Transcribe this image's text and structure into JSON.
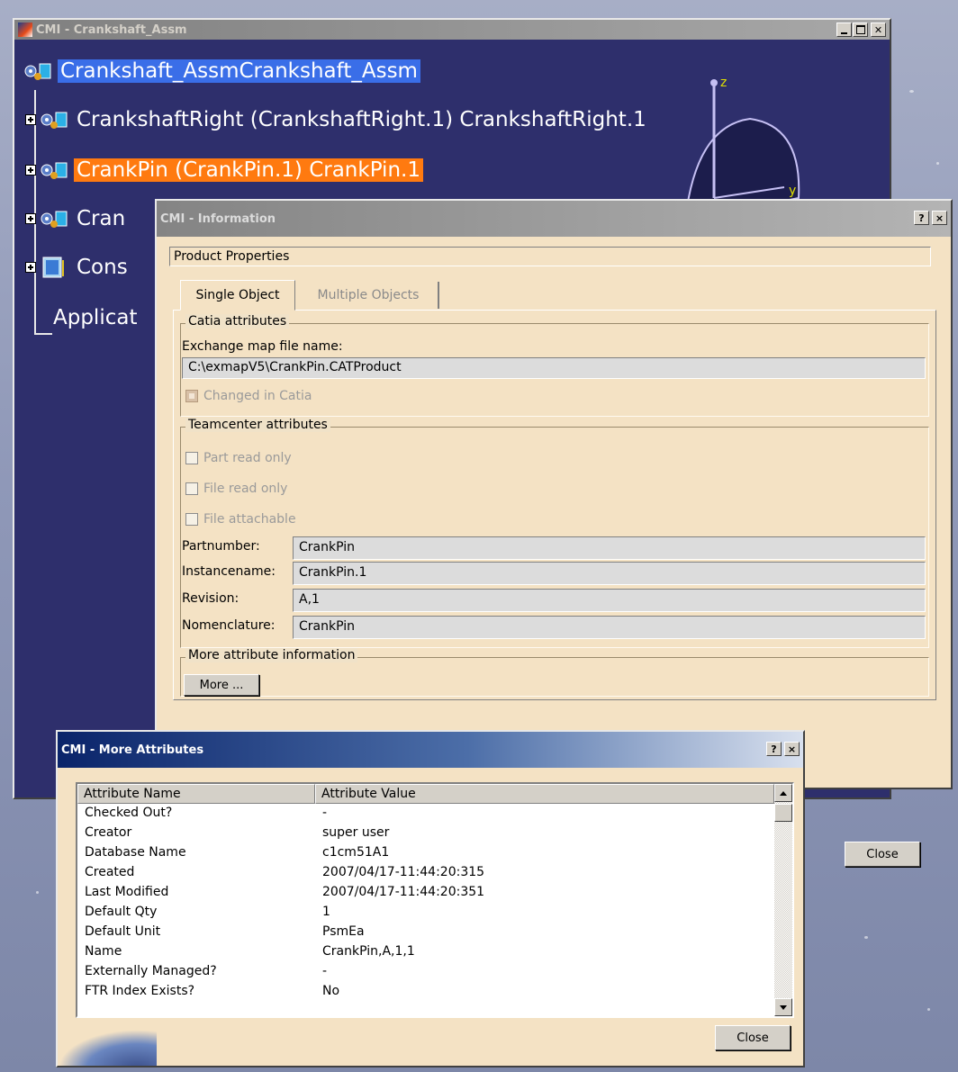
{
  "tree_window": {
    "title": "CMI - Crankshaft_Assm",
    "root": "Crankshaft_AssmCrankshaft_Assm",
    "items": [
      "CrankshaftRight (CrankshaftRight.1) CrankshaftRight.1",
      "CrankPin (CrankPin.1) CrankPin.1",
      "Cran",
      "Cons",
      "Applicat"
    ],
    "axis_z": "z",
    "axis_y": "y"
  },
  "info_dialog": {
    "title": "CMI - Information",
    "help_label": "?",
    "close_x": "×",
    "product_properties": "Product Properties",
    "tabs": [
      "Single Object",
      "Multiple Objects"
    ],
    "catia_group": "Catia attributes",
    "exchange_label": "Exchange map file name:",
    "exchange_value": "C:\\exmapV5\\CrankPin.CATProduct",
    "changed_in_catia": "Changed in Catia",
    "teamcenter_group": "Teamcenter attributes",
    "checkboxes": [
      "Part read only",
      "File read only",
      "File attachable"
    ],
    "fields": [
      {
        "label": "Partnumber:",
        "value": "CrankPin"
      },
      {
        "label": "Instancename:",
        "value": "CrankPin.1"
      },
      {
        "label": "Revision:",
        "value": "A,1"
      },
      {
        "label": "Nomenclature:",
        "value": "CrankPin"
      }
    ],
    "more_group": "More attribute information",
    "more_button": "More ...",
    "close_button": "Close"
  },
  "more_dialog": {
    "title": "CMI - More Attributes",
    "help_label": "?",
    "close_x": "×",
    "columns": [
      "Attribute Name",
      "Attribute Value"
    ],
    "rows": [
      [
        "Checked Out?",
        "-"
      ],
      [
        "Creator",
        "super user"
      ],
      [
        "Database Name",
        "c1cm51A1"
      ],
      [
        "Created",
        "2007/04/17-11:44:20:315"
      ],
      [
        "Last Modified",
        "2007/04/17-11:44:20:351"
      ],
      [
        "Default Qty",
        "1"
      ],
      [
        "Default Unit",
        "PsmEa"
      ],
      [
        "Name",
        "CrankPin,A,1,1"
      ],
      [
        "Externally Managed?",
        "-"
      ],
      [
        "FTR Index Exists?",
        "No"
      ]
    ],
    "close_button": "Close"
  },
  "colors": {
    "tree_bg": "#2e2f6c",
    "selection_blue": "#3a6ee8",
    "selection_orange": "#ff7a10",
    "dialog_bg": "#f4e2c4"
  }
}
